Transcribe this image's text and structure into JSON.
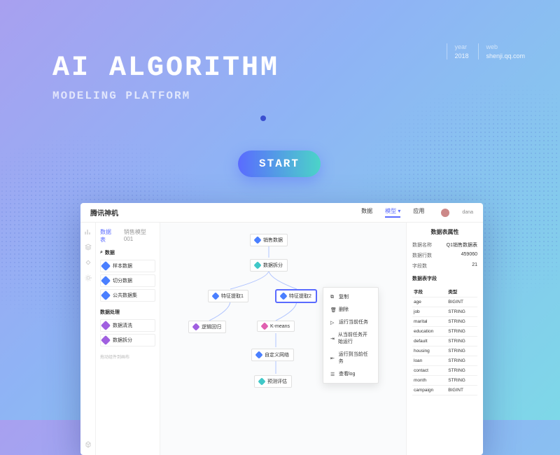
{
  "hero": {
    "title": "AI ALGORITHM",
    "subtitle": "MODELING PLATFORM"
  },
  "meta": {
    "year_label": "year",
    "year": "2018",
    "web_label": "web",
    "web": "shenji.qq.com"
  },
  "start_label": "START",
  "topbar": {
    "brand": "腾讯神机",
    "tabs": [
      "数据",
      "模型",
      "应用"
    ],
    "active_tab": 1,
    "user_name": "dana"
  },
  "side_tabs": {
    "left": "数据表",
    "right": "销售模型001"
  },
  "sidebar": {
    "group1": {
      "title": "数据",
      "items": [
        {
          "label": "样本数据",
          "color": "blue"
        },
        {
          "label": "切分数据",
          "color": "blue"
        },
        {
          "label": "公共数据集",
          "color": "blue"
        }
      ]
    },
    "group2": {
      "title": "数据处理",
      "items": [
        {
          "label": "数据清洗",
          "color": "purple"
        },
        {
          "label": "数据拆分",
          "color": "purple"
        }
      ]
    },
    "note": "拖动组件到画布"
  },
  "nodes": {
    "n1": "销售数据",
    "n2": "数据拆分",
    "n3": "特征提取1",
    "n4": "特征提取2",
    "n5": "逻辑回归",
    "n6": "K-means",
    "n7": "自定义网络",
    "n8": "预测评估"
  },
  "ctx_menu": [
    "复制",
    "删除",
    "运行当前任务",
    "从当前任务开始运行",
    "运行到当前任务",
    "查看log"
  ],
  "rpanel": {
    "title": "数据表属性",
    "rows": {
      "name_k": "数据名称",
      "name_v": "Q1销售数据表",
      "rows_k": "数据行数",
      "rows_v": "459060",
      "cols_k": "字段数",
      "cols_v": "21"
    },
    "fields_title": "数据表字段",
    "th_field": "字段",
    "th_type": "类型",
    "fields": [
      {
        "f": "age",
        "t": "BIGINT"
      },
      {
        "f": "job",
        "t": "STRING"
      },
      {
        "f": "marital",
        "t": "STRING"
      },
      {
        "f": "education",
        "t": "STRING"
      },
      {
        "f": "default",
        "t": "STRING"
      },
      {
        "f": "housing",
        "t": "STRING"
      },
      {
        "f": "loan",
        "t": "STRING"
      },
      {
        "f": "contact",
        "t": "STRING"
      },
      {
        "f": "month",
        "t": "STRING"
      },
      {
        "f": "campaign",
        "t": "BIGINT"
      }
    ]
  }
}
